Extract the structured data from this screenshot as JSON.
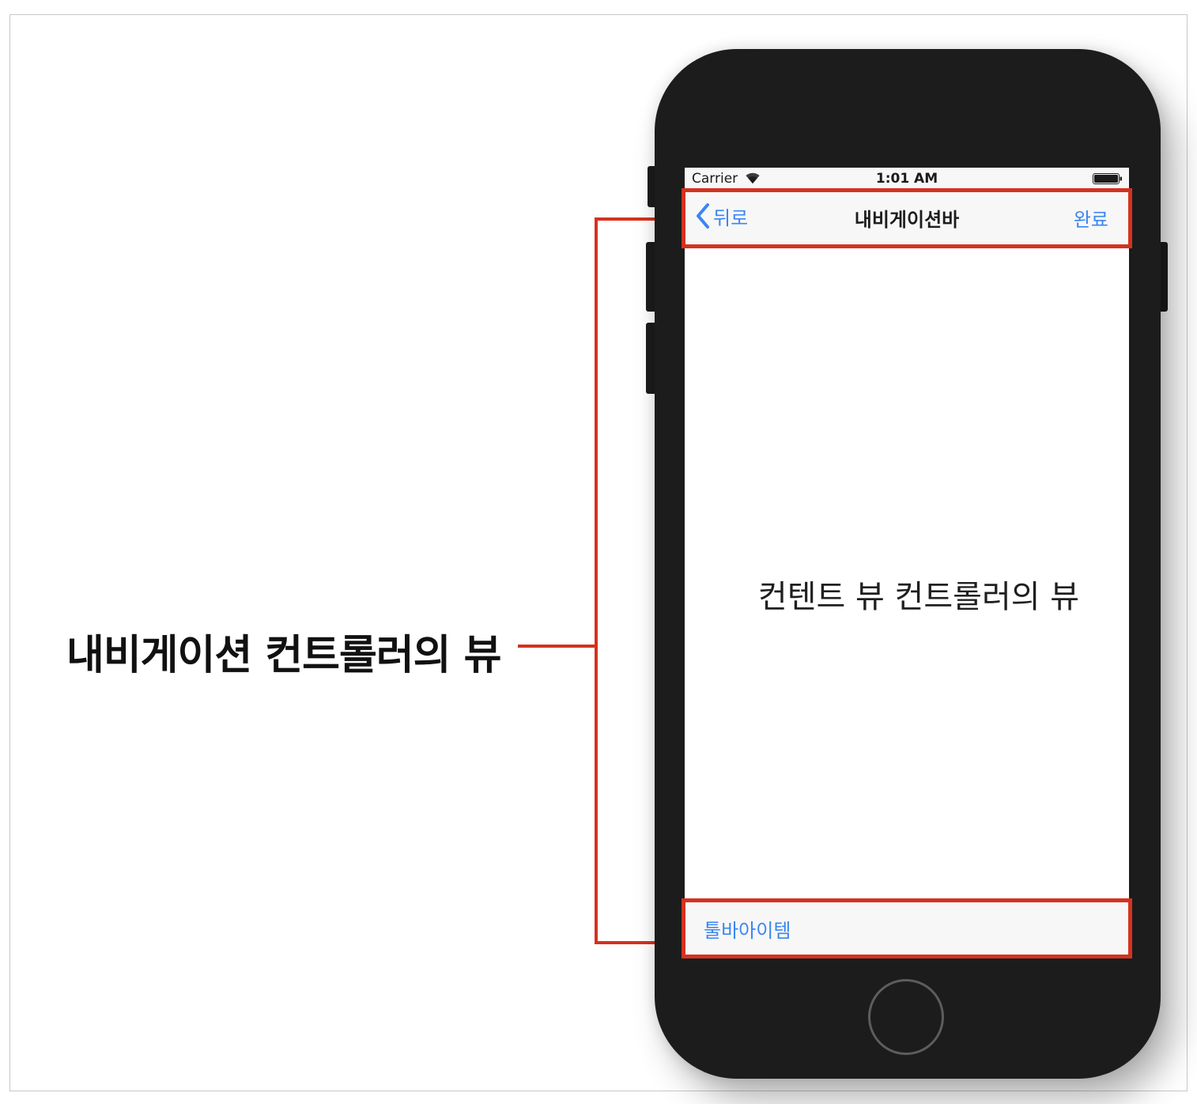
{
  "callout": {
    "label": "내비게이션 컨트롤러의 뷰"
  },
  "status_bar": {
    "carrier": "Carrier",
    "time": "1:01 AM"
  },
  "nav_bar": {
    "back_label": "뒤로",
    "title": "내비게이션바",
    "done_label": "완료"
  },
  "content": {
    "label": "컨텐트 뷰 컨트롤러의 뷰"
  },
  "toolbar": {
    "item_label": "툴바아이템"
  },
  "colors": {
    "highlight": "#d4321f",
    "tint": "#3a86f2",
    "device": "#1c1c1c"
  }
}
